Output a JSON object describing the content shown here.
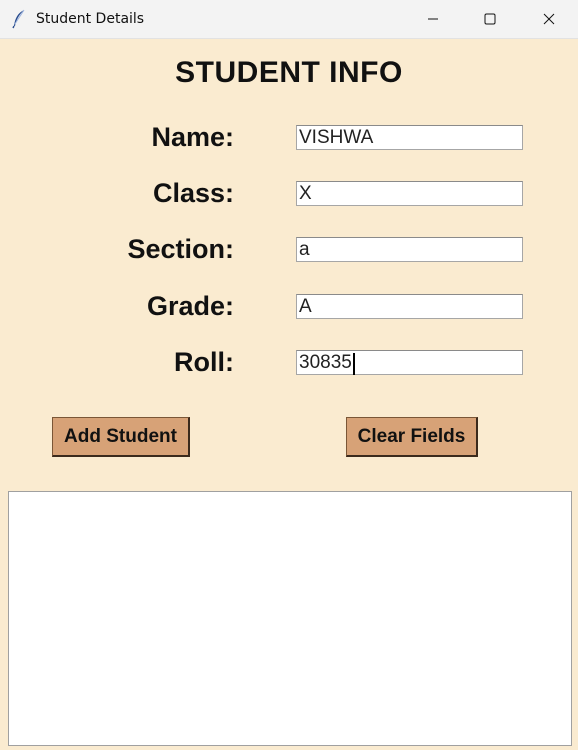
{
  "window": {
    "title": "Student Details",
    "icon": "feather-icon"
  },
  "form": {
    "heading": "STUDENT INFO",
    "fields": {
      "name": {
        "label": "Name:",
        "value": "VISHWA"
      },
      "class": {
        "label": "Class:",
        "value": "X"
      },
      "section": {
        "label": "Section:",
        "value": "a"
      },
      "grade": {
        "label": "Grade:",
        "value": "A"
      },
      "roll": {
        "label": "Roll:",
        "value": "30835"
      }
    }
  },
  "buttons": {
    "add": "Add Student",
    "clear": "Clear Fields"
  },
  "student_list": {
    "items": []
  },
  "colors": {
    "background": "#faebd0",
    "button": "#d7a277"
  }
}
